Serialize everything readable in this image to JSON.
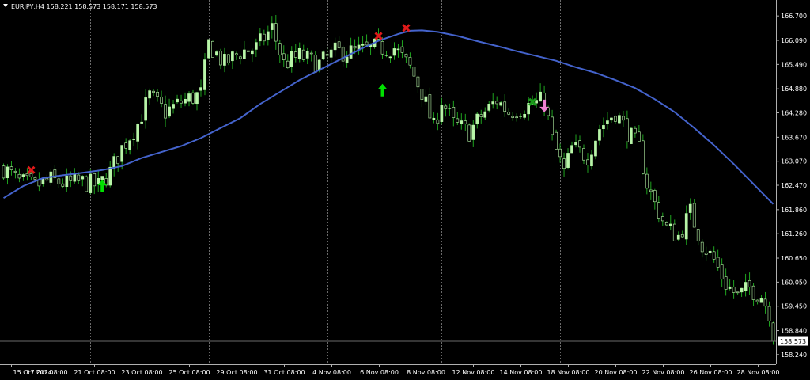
{
  "header": {
    "symbol_info": "EURJPY,H4  158.221 158.573 158.171 158.573",
    "triangle_icon": "down-triangle-icon"
  },
  "colors": {
    "background": "#000000",
    "candle": "#b8f5a8",
    "wick": "#1fa41f",
    "ma_line": "#4463cc",
    "grid": "#6a6a6a",
    "axis": "#b0b0b0",
    "text": "#ffffff",
    "buy_arrow": "#00e000",
    "sell_arrow": "#ee82d0",
    "exit_cross": "#e01a1a",
    "exit_cross_green": "#1a9a1a"
  },
  "chart_data": {
    "type": "candlestick",
    "symbol": "EURJPY",
    "timeframe": "H4",
    "ohlc_header": {
      "open": 158.221,
      "high": 158.573,
      "low": 158.171,
      "close": 158.573
    },
    "current_price": 158.573,
    "ylim": [
      158.0,
      167.0
    ],
    "y_ticks": [
      166.7,
      166.09,
      165.49,
      164.88,
      164.28,
      163.67,
      163.07,
      162.47,
      161.86,
      161.26,
      160.65,
      160.05,
      159.45,
      158.84,
      158.24
    ],
    "y_tick_labels": [
      "166.700",
      "166.090",
      "165.490",
      "164.880",
      "164.280",
      "163.670",
      "163.070",
      "162.470",
      "161.860",
      "161.260",
      "160.650",
      "160.050",
      "159.450",
      "158.840",
      "158.240"
    ],
    "x_tick_labels": [
      "15 Oct 2024",
      "17 Oct 08:00",
      "21 Oct 08:00",
      "23 Oct 08:00",
      "25 Oct 08:00",
      "29 Oct 08:00",
      "31 Oct 08:00",
      "4 Nov 08:00",
      "6 Nov 08:00",
      "8 Nov 08:00",
      "12 Nov 08:00",
      "14 Nov 08:00",
      "18 Nov 08:00",
      "20 Nov 08:00",
      "22 Nov 08:00",
      "26 Nov 08:00",
      "28 Nov 08:00"
    ],
    "x_tick_positions": [
      2,
      11,
      23,
      35,
      47,
      59,
      71,
      83,
      95,
      107,
      119,
      131,
      143,
      155,
      167,
      179,
      191
    ],
    "vertical_grid_positions": [
      22,
      52,
      82,
      111,
      141,
      171
    ],
    "bar_count": 196,
    "close_path": [
      [
        0,
        162.9
      ],
      [
        4,
        162.55
      ],
      [
        8,
        162.45
      ],
      [
        12,
        162.6
      ],
      [
        16,
        162.5
      ],
      [
        20,
        162.55
      ],
      [
        24,
        162.45
      ],
      [
        27,
        162.8
      ],
      [
        30,
        163.4
      ],
      [
        34,
        164.0
      ],
      [
        37,
        164.7
      ],
      [
        41,
        164.3
      ],
      [
        45,
        164.55
      ],
      [
        50,
        164.75
      ],
      [
        52,
        166.0
      ],
      [
        56,
        165.5
      ],
      [
        60,
        165.8
      ],
      [
        64,
        165.9
      ],
      [
        68,
        166.4
      ],
      [
        71,
        165.5
      ],
      [
        75,
        165.7
      ],
      [
        80,
        165.5
      ],
      [
        84,
        165.8
      ],
      [
        89,
        165.8
      ],
      [
        94,
        165.9
      ],
      [
        99,
        165.9
      ],
      [
        103,
        165.4
      ],
      [
        106,
        164.8
      ],
      [
        109,
        163.9
      ],
      [
        111,
        164.6
      ],
      [
        114,
        164.0
      ],
      [
        118,
        163.8
      ],
      [
        121,
        164.2
      ],
      [
        125,
        164.6
      ],
      [
        128,
        164.3
      ],
      [
        131,
        164.4
      ],
      [
        134,
        164.5
      ],
      [
        137,
        164.6
      ],
      [
        139,
        163.6
      ],
      [
        142,
        162.8
      ],
      [
        144,
        163.4
      ],
      [
        148,
        163.2
      ],
      [
        151,
        163.9
      ],
      [
        155,
        164.3
      ],
      [
        158,
        163.8
      ],
      [
        161,
        163.4
      ],
      [
        163,
        162.5
      ],
      [
        165,
        162.0
      ],
      [
        168,
        161.4
      ],
      [
        171,
        161.2
      ],
      [
        174,
        161.8
      ],
      [
        177,
        161.0
      ],
      [
        180,
        160.6
      ],
      [
        183,
        160.0
      ],
      [
        186,
        159.7
      ],
      [
        189,
        159.9
      ],
      [
        192,
        159.7
      ],
      [
        194,
        159.3
      ],
      [
        195,
        158.45
      ]
    ],
    "ma_series": {
      "values": [
        [
          0,
          162.15
        ],
        [
          5,
          162.45
        ],
        [
          10,
          162.65
        ],
        [
          15,
          162.72
        ],
        [
          20,
          162.78
        ],
        [
          25,
          162.85
        ],
        [
          30,
          162.95
        ],
        [
          35,
          163.15
        ],
        [
          40,
          163.3
        ],
        [
          45,
          163.45
        ],
        [
          50,
          163.65
        ],
        [
          55,
          163.9
        ],
        [
          60,
          164.15
        ],
        [
          65,
          164.5
        ],
        [
          70,
          164.8
        ],
        [
          75,
          165.1
        ],
        [
          80,
          165.35
        ],
        [
          85,
          165.6
        ],
        [
          90,
          165.85
        ],
        [
          95,
          166.08
        ],
        [
          100,
          166.25
        ],
        [
          103,
          166.33
        ],
        [
          106,
          166.34
        ],
        [
          110,
          166.3
        ],
        [
          115,
          166.2
        ],
        [
          120,
          166.07
        ],
        [
          125,
          165.95
        ],
        [
          130,
          165.82
        ],
        [
          135,
          165.7
        ],
        [
          140,
          165.58
        ],
        [
          145,
          165.42
        ],
        [
          150,
          165.28
        ],
        [
          155,
          165.1
        ],
        [
          160,
          164.9
        ],
        [
          165,
          164.62
        ],
        [
          170,
          164.3
        ],
        [
          175,
          163.9
        ],
        [
          180,
          163.47
        ],
        [
          185,
          163.0
        ],
        [
          190,
          162.5
        ],
        [
          195,
          162.0
        ]
      ]
    },
    "signals": [
      {
        "kind": "exit_cross",
        "bar": 7,
        "price": 162.85,
        "color_key": "exit_cross"
      },
      {
        "kind": "buy_arrow",
        "bar": 25,
        "price": 162.45,
        "color_key": "buy_arrow"
      },
      {
        "kind": "exit_cross",
        "bar": 95,
        "price": 166.2,
        "color_key": "exit_cross"
      },
      {
        "kind": "exit_cross",
        "bar": 102,
        "price": 166.4,
        "color_key": "exit_cross"
      },
      {
        "kind": "buy_arrow",
        "bar": 96,
        "price": 164.85,
        "color_key": "buy_arrow"
      },
      {
        "kind": "exit_cross",
        "bar": 134,
        "price": 164.55,
        "color_key": "exit_cross_green"
      },
      {
        "kind": "sell_arrow",
        "bar": 137,
        "price": 164.45,
        "color_key": "sell_arrow"
      }
    ]
  }
}
